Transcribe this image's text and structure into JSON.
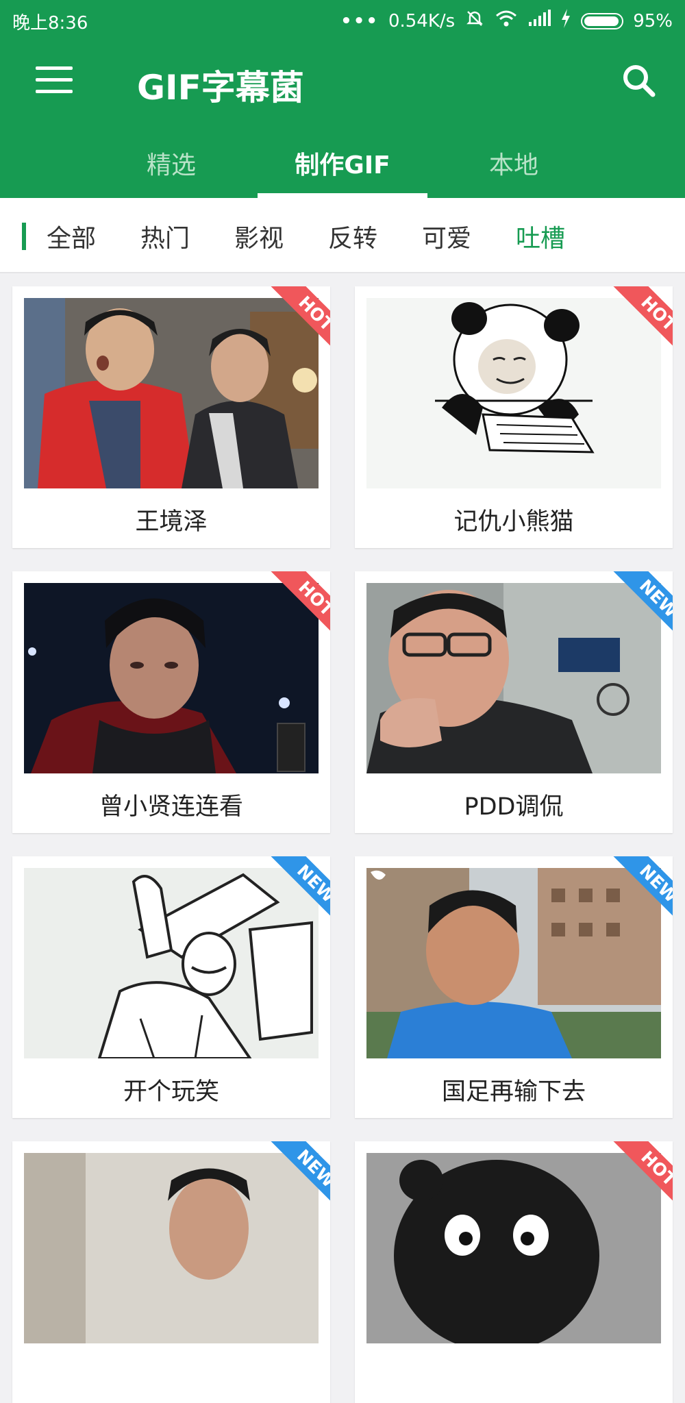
{
  "status_bar": {
    "time": "晚上8:36",
    "dots": "•••",
    "network_speed": "0.54K/s",
    "battery": "95%",
    "battery_level": 0.95
  },
  "app_bar": {
    "title": "GIF字幕菌",
    "menu_icon": "hamburger-menu-icon",
    "search_icon": "search-icon"
  },
  "tabs": [
    {
      "label": "精选",
      "active": false
    },
    {
      "label": "制作GIF",
      "active": true
    },
    {
      "label": "本地",
      "active": false
    }
  ],
  "filters": [
    {
      "label": "全部"
    },
    {
      "label": "热门"
    },
    {
      "label": "影视"
    },
    {
      "label": "反转"
    },
    {
      "label": "可爱"
    },
    {
      "label": "吐槽",
      "selected": true
    }
  ],
  "cards": [
    {
      "title": "王境泽",
      "badge": "HOT"
    },
    {
      "title": "记仇小熊猫",
      "badge": "HOT"
    },
    {
      "title": "曾小贤连连看",
      "badge": "HOT"
    },
    {
      "title": "PDD调侃",
      "badge": "NEW"
    },
    {
      "title": "开个玩笑",
      "badge": "NEW"
    },
    {
      "title": "国足再输下去",
      "badge": "NEW"
    },
    {
      "title": "",
      "badge": "NEW"
    },
    {
      "title": "",
      "badge": "HOT"
    }
  ],
  "colors": {
    "primary_green": "#179b52",
    "hot_badge": "#f0575b",
    "new_badge": "#2f95e8",
    "background": "#f1f1f3"
  }
}
